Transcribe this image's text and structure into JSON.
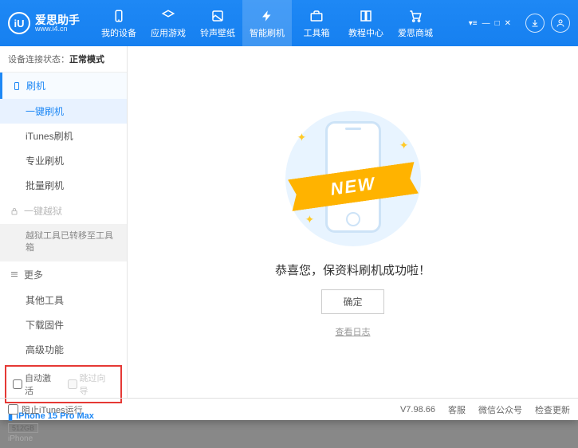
{
  "app": {
    "name": "爱思助手",
    "url": "www.i4.cn",
    "logo_letter": "iU"
  },
  "nav": {
    "items": [
      {
        "label": "我的设备"
      },
      {
        "label": "应用游戏"
      },
      {
        "label": "铃声壁纸"
      },
      {
        "label": "智能刷机"
      },
      {
        "label": "工具箱"
      },
      {
        "label": "教程中心"
      },
      {
        "label": "爱思商城"
      }
    ],
    "active_index": 3
  },
  "sidebar": {
    "conn_label": "设备连接状态：",
    "conn_value": "正常模式",
    "sec_flash": "刷机",
    "items_flash": [
      "一键刷机",
      "iTunes刷机",
      "专业刷机",
      "批量刷机"
    ],
    "active_flash_index": 0,
    "sec_jail": "一键越狱",
    "jail_note": "越狱工具已转移至工具箱",
    "sec_more": "更多",
    "items_more": [
      "其他工具",
      "下载固件",
      "高级功能"
    ],
    "chk_auto": "自动激活",
    "chk_skip": "跳过向导"
  },
  "device": {
    "name": "iPhone 15 Pro Max",
    "storage": "512GB",
    "type": "iPhone"
  },
  "main": {
    "ribbon": "NEW",
    "message": "恭喜您，保资料刷机成功啦！",
    "ok": "确定",
    "log": "查看日志"
  },
  "status": {
    "block_itunes": "阻止iTunes运行",
    "version": "V7.98.66",
    "links": [
      "客服",
      "微信公众号",
      "检查更新"
    ]
  }
}
